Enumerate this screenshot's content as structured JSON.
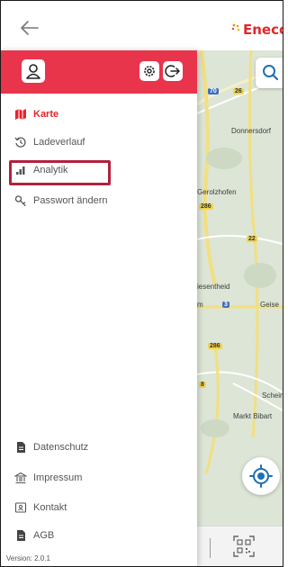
{
  "brand": {
    "name": "Eneco"
  },
  "drawer": {
    "menu_top": [
      {
        "label": "Karte",
        "icon": "map-icon",
        "active": true
      },
      {
        "label": "Ladeverlauf",
        "icon": "history-icon",
        "active": false
      },
      {
        "label": "Analytik",
        "icon": "bar-chart-icon",
        "active": false
      },
      {
        "label": "Passwort ändern",
        "icon": "key-icon",
        "active": false
      }
    ],
    "menu_bottom": [
      {
        "label": "Datenschutz",
        "icon": "document-icon"
      },
      {
        "label": "Impressum",
        "icon": "building-icon"
      },
      {
        "label": "Kontakt",
        "icon": "contact-card-icon"
      },
      {
        "label": "AGB",
        "icon": "document-icon"
      }
    ],
    "version": "Version: 2.0.1"
  },
  "map": {
    "places": [
      "Donnersdorf",
      "Gerolzhofen",
      "iesentheid",
      "Geise",
      "Schein",
      "Markt Bibart",
      "m"
    ],
    "road_numbers": [
      "70",
      "26",
      "286",
      "22",
      "3",
      "286",
      "8"
    ]
  },
  "colors": {
    "accent": "#e8354c",
    "brand_red": "#e3262d",
    "highlight": "#b4203f"
  }
}
